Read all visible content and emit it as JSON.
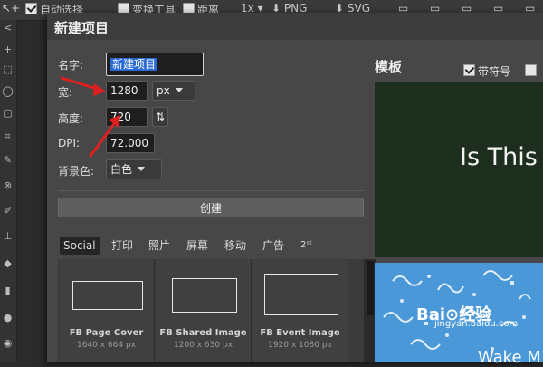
{
  "topbar": {
    "auto_select": "自动选择",
    "transform": "变换工具",
    "distance": "距离",
    "zoom": "1x",
    "png": "PNG",
    "svg": "SVG"
  },
  "dialog": {
    "title": "新建项目",
    "name_label": "名字:",
    "name_value": "新建项目",
    "width_label": "宽:",
    "width_value": "1280",
    "unit_value": "px",
    "height_label": "高度:",
    "height_value": "720",
    "dpi_label": "DPI:",
    "dpi_value": "72.000",
    "bg_label": "背景色:",
    "bg_value": "白色",
    "create_label": "创建"
  },
  "tabs": [
    "Social",
    "打印",
    "照片",
    "屏幕",
    "移动",
    "广告",
    "2ˢᵗ"
  ],
  "templates": [
    {
      "name": "FB Page Cover",
      "size": "1640 x 664 px"
    },
    {
      "name": "FB Shared Image",
      "size": "1200 x 630 px"
    },
    {
      "name": "FB Event Image",
      "size": "1920 x 1080 px"
    }
  ],
  "right_panel": {
    "title": "模板",
    "bleed_label": "带符号",
    "preview1_text": "Is This",
    "preview2_text": "Wake M"
  },
  "watermark": {
    "logo": "Bai⊙经验",
    "url": "jingyan.baidu.com"
  },
  "colors": {
    "accent_arrow": "#e02020",
    "selection": "#2b6ad4"
  }
}
